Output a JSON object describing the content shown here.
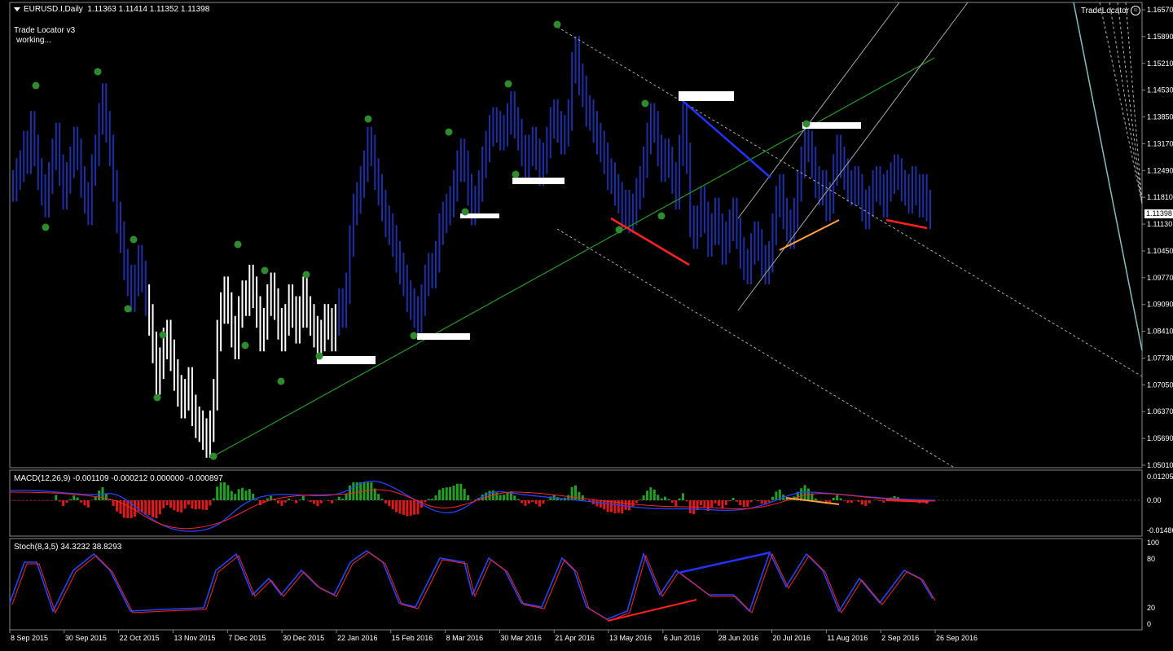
{
  "symbol_header": "EURUSD.I,Daily  1.11363 1.11414 1.11352 1.11398",
  "indicator": {
    "name": "Trade Locator v3",
    "status": "working..."
  },
  "top_right_label": "TradeLocator",
  "current_price": "1.11398",
  "price_axis": [
    "1.16570",
    "1.15890",
    "1.15210",
    "1.14530",
    "1.13850",
    "1.13170",
    "1.12490",
    "1.11810",
    "1.11130",
    "1.10450",
    "1.09770",
    "1.09090",
    "1.08410",
    "1.07730",
    "1.07050",
    "1.06370",
    "1.05690",
    "1.05010"
  ],
  "macd": {
    "title": "MACD(12,26,9) -0.001109 -0.000212 0.000000 -0.000897",
    "axis": [
      "0.01205",
      "0.00",
      "-0.01486"
    ]
  },
  "stoch": {
    "title": "Stoch(8,3,5) 34.3232 38.8293",
    "axis": [
      "100",
      "80",
      "20",
      "0"
    ]
  },
  "time_axis": [
    "8 Sep 2015",
    "30 Sep 2015",
    "22 Oct 2015",
    "13 Nov 2015",
    "7 Dec 2015",
    "30 Dec 2015",
    "22 Jan 2016",
    "15 Feb 2016",
    "8 Mar 2016",
    "30 Mar 2016",
    "21 Apr 2016",
    "13 May 2016",
    "6 Jun 2016",
    "28 Jun 2016",
    "20 Jul 2016",
    "11 Aug 2016",
    "2 Sep 2016",
    "26 Sep 2016"
  ],
  "colors": {
    "bull_bar": "#1c2ea8",
    "bear_bar": "#ffffff",
    "swing_dot": "#2e8b2e",
    "trendline": "#1f9a1f",
    "macd_pos": "#22a022",
    "macd_neg": "#e01818",
    "stoch_main": "#2244ff",
    "stoch_signal": "#ff2222"
  },
  "chart_data": {
    "type": "ohlc",
    "symbol": "EURUSD.I",
    "timeframe": "Daily",
    "last_bar": {
      "open": 1.11363,
      "high": 1.11414,
      "low": 1.11352,
      "close": 1.11398
    },
    "y_range": [
      1.0501,
      1.1657
    ],
    "close_series": [
      1.121,
      1.124,
      1.126,
      1.131,
      1.128,
      1.136,
      1.13,
      1.124,
      1.12,
      1.117,
      1.123,
      1.129,
      1.133,
      1.125,
      1.119,
      1.123,
      1.127,
      1.132,
      1.129,
      1.122,
      1.118,
      1.115,
      1.125,
      1.13,
      1.138,
      1.143,
      1.136,
      1.13,
      1.121,
      1.113,
      1.108,
      1.101,
      1.097,
      1.093,
      1.097,
      1.102,
      1.098,
      1.092,
      1.087,
      1.08,
      1.072,
      1.076,
      1.081,
      1.083,
      1.078,
      1.073,
      1.069,
      1.066,
      1.068,
      1.071,
      1.064,
      1.061,
      1.06,
      1.058,
      1.056,
      1.06,
      1.068,
      1.083,
      1.09,
      1.094,
      1.09,
      1.084,
      1.081,
      1.089,
      1.093,
      1.092,
      1.097,
      1.094,
      1.089,
      1.083,
      1.086,
      1.092,
      1.095,
      1.091,
      1.086,
      1.083,
      1.087,
      1.092,
      1.089,
      1.085,
      1.089,
      1.094,
      1.089,
      1.087,
      1.084,
      1.08,
      1.083,
      1.087,
      1.086,
      1.083,
      1.087,
      1.091,
      1.089,
      1.095,
      1.107,
      1.115,
      1.118,
      1.122,
      1.126,
      1.132,
      1.13,
      1.124,
      1.12,
      1.116,
      1.112,
      1.11,
      1.107,
      1.103,
      1.1,
      1.097,
      1.093,
      1.091,
      1.089,
      1.086,
      1.092,
      1.097,
      1.1,
      1.099,
      1.103,
      1.11,
      1.113,
      1.115,
      1.117,
      1.121,
      1.126,
      1.129,
      1.126,
      1.12,
      1.115,
      1.117,
      1.121,
      1.127,
      1.131,
      1.135,
      1.137,
      1.136,
      1.134,
      1.135,
      1.138,
      1.141,
      1.137,
      1.134,
      1.13,
      1.127,
      1.13,
      1.132,
      1.129,
      1.125,
      1.128,
      1.132,
      1.137,
      1.139,
      1.136,
      1.133,
      1.135,
      1.139,
      1.151,
      1.155,
      1.148,
      1.145,
      1.14,
      1.139,
      1.136,
      1.133,
      1.131,
      1.128,
      1.124,
      1.123,
      1.12,
      1.118,
      1.114,
      1.116,
      1.113,
      1.115,
      1.119,
      1.122,
      1.127,
      1.133,
      1.138,
      1.136,
      1.13,
      1.126,
      1.129,
      1.127,
      1.123,
      1.119,
      1.13,
      1.138,
      1.128,
      1.112,
      1.109,
      1.112,
      1.117,
      1.113,
      1.107,
      1.11,
      1.114,
      1.11,
      1.105,
      1.108,
      1.111,
      1.114,
      1.109,
      1.104,
      1.101,
      1.1,
      1.105,
      1.108,
      1.106,
      1.102,
      1.1,
      1.103,
      1.11,
      1.117,
      1.12,
      1.114,
      1.111,
      1.109,
      1.114,
      1.121,
      1.127,
      1.133,
      1.131,
      1.127,
      1.122,
      1.12,
      1.121,
      1.116,
      1.118,
      1.125,
      1.13,
      1.127,
      1.124,
      1.121,
      1.12,
      1.122,
      1.12,
      1.116,
      1.114,
      1.117,
      1.121,
      1.122,
      1.12,
      1.117,
      1.121,
      1.123,
      1.125,
      1.124,
      1.121,
      1.12,
      1.118,
      1.122,
      1.12,
      1.117,
      1.12,
      1.116,
      1.114
    ]
  }
}
